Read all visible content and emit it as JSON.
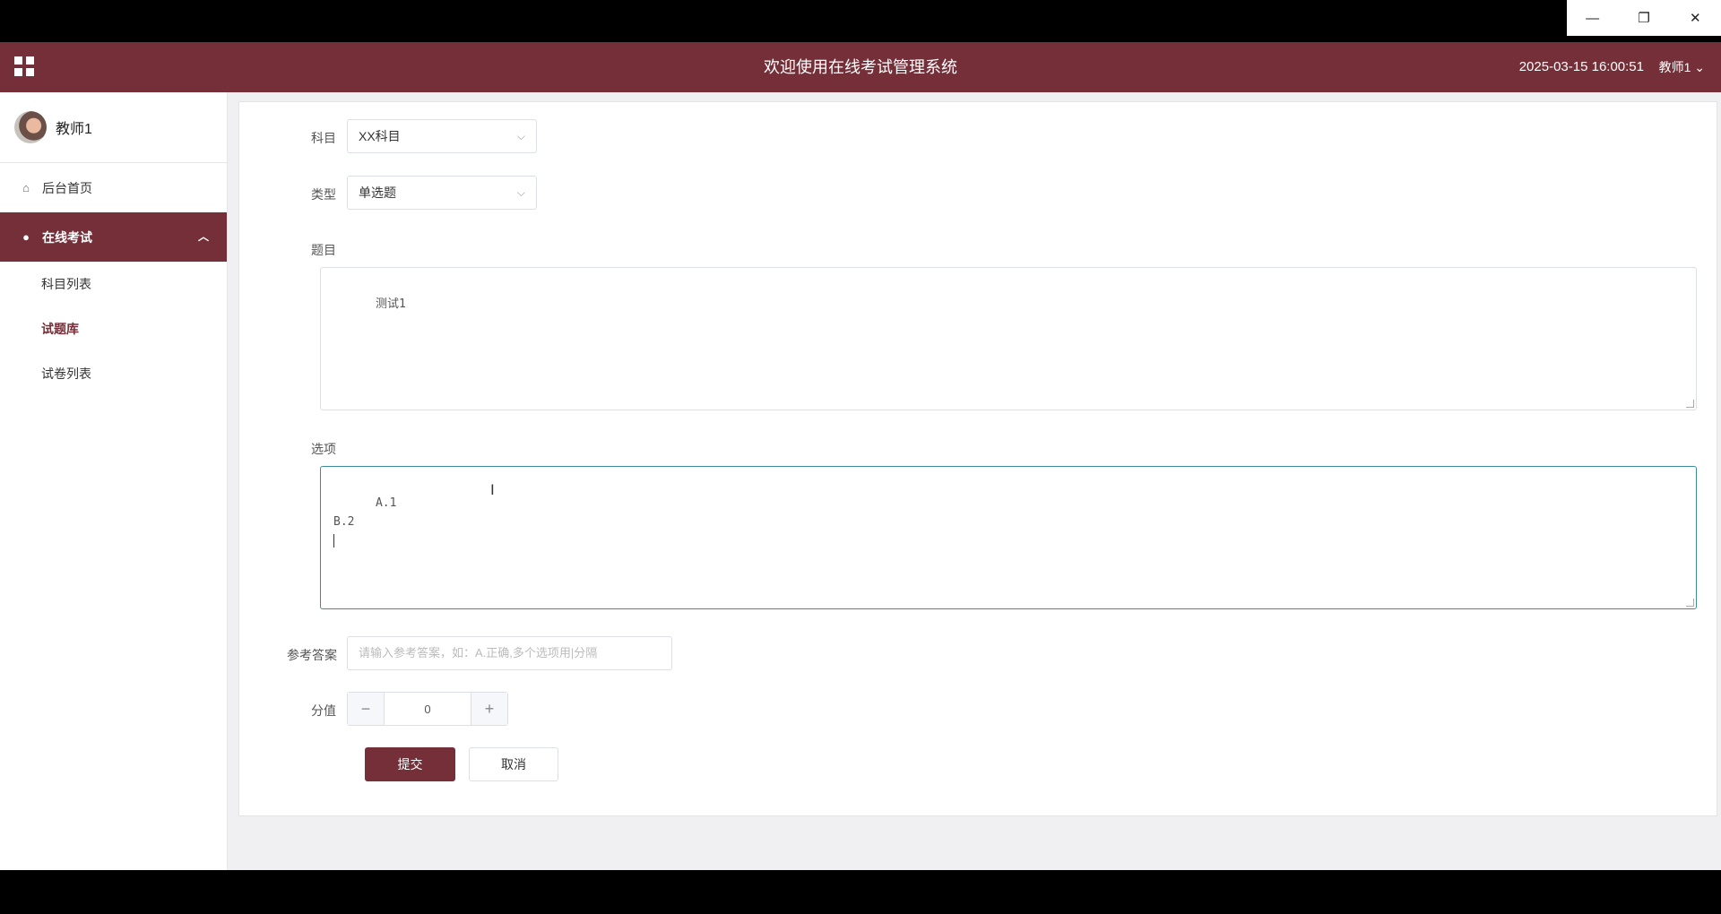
{
  "window": {
    "minimize": "—",
    "restore": "❐",
    "close": "✕"
  },
  "header": {
    "title": "欢迎使用在线考试管理系统",
    "datetime": "2025-03-15 16:00:51",
    "user": "教师1",
    "user_caret": "⌄",
    "brand_color": "#742f39"
  },
  "sidebar": {
    "profile_name": "教师1",
    "items": [
      {
        "label": "后台首页",
        "icon": "home-icon"
      },
      {
        "label": "在线考试",
        "icon": "bulb-icon",
        "expanded": true
      }
    ],
    "sub_items": [
      {
        "label": "科目列表"
      },
      {
        "label": "试题库",
        "current": true
      },
      {
        "label": "试卷列表"
      }
    ]
  },
  "form": {
    "subject_label": "科目",
    "subject_value": "XX科目",
    "type_label": "类型",
    "type_value": "单选题",
    "question_label": "题目",
    "question_value": "测试1",
    "options_label": "选项",
    "options_value": "A.1\nB.2\n",
    "answer_label": "参考答案",
    "answer_placeholder": "请输入参考答案，如：A.正确,多个选项用|分隔",
    "score_label": "分值",
    "score_value": "0",
    "minus": "−",
    "plus": "+",
    "submit_label": "提交",
    "cancel_label": "取消"
  }
}
